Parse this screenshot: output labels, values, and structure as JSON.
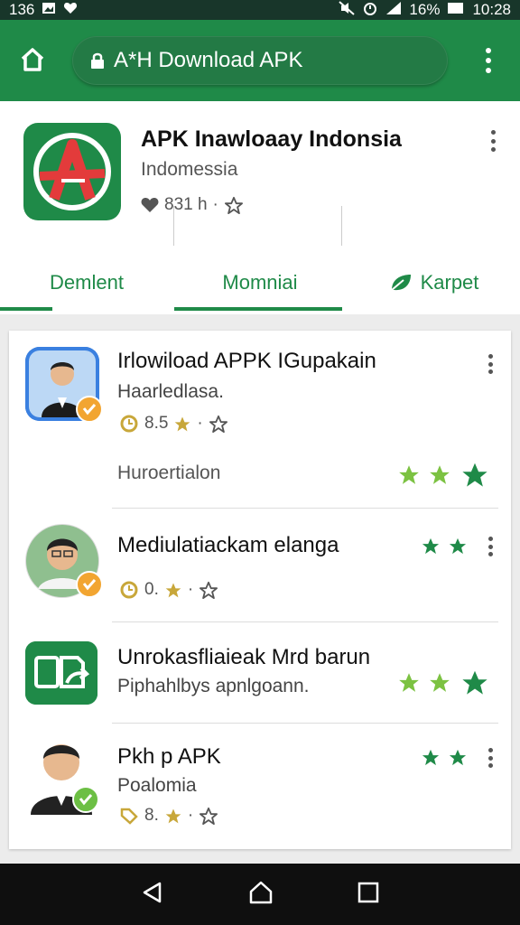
{
  "status_bar": {
    "left_text": "136",
    "battery": "16%",
    "time": "10:28"
  },
  "browser": {
    "url_text": "A*H Download APK"
  },
  "app": {
    "title": "APK Inawloaay Indonsia",
    "subtitle": "Indomessia",
    "meta_count": "831 h",
    "logo_letter": "A"
  },
  "tabs": [
    {
      "label": "Demlent"
    },
    {
      "label": "Momniai"
    },
    {
      "label": "Karpet",
      "icon": "leaf-icon"
    }
  ],
  "items": [
    {
      "title": "Irlowiload APPK IGupakain",
      "subtitle": "Haarledlasa.",
      "rating": "8.5",
      "extra": "Huroertialon",
      "stars_right": 3
    },
    {
      "title": "Mediulatiackam elanga",
      "rating": "0.",
      "stars_right": 2
    },
    {
      "title": "Unrokasfliaieak Mrd barun",
      "subtitle": "Piphahlbys apnlgoann.",
      "stars_right": 3
    },
    {
      "title": "Pkh p APK",
      "subtitle": "Poalomia",
      "rating": "8.",
      "stars_right": 2
    }
  ],
  "colors": {
    "brand_green": "#1f8a48",
    "star_green": "#1f8a48",
    "star_lime": "#7cc242",
    "badge_orange": "#f2a531",
    "rating_gold": "#c8a73a"
  }
}
